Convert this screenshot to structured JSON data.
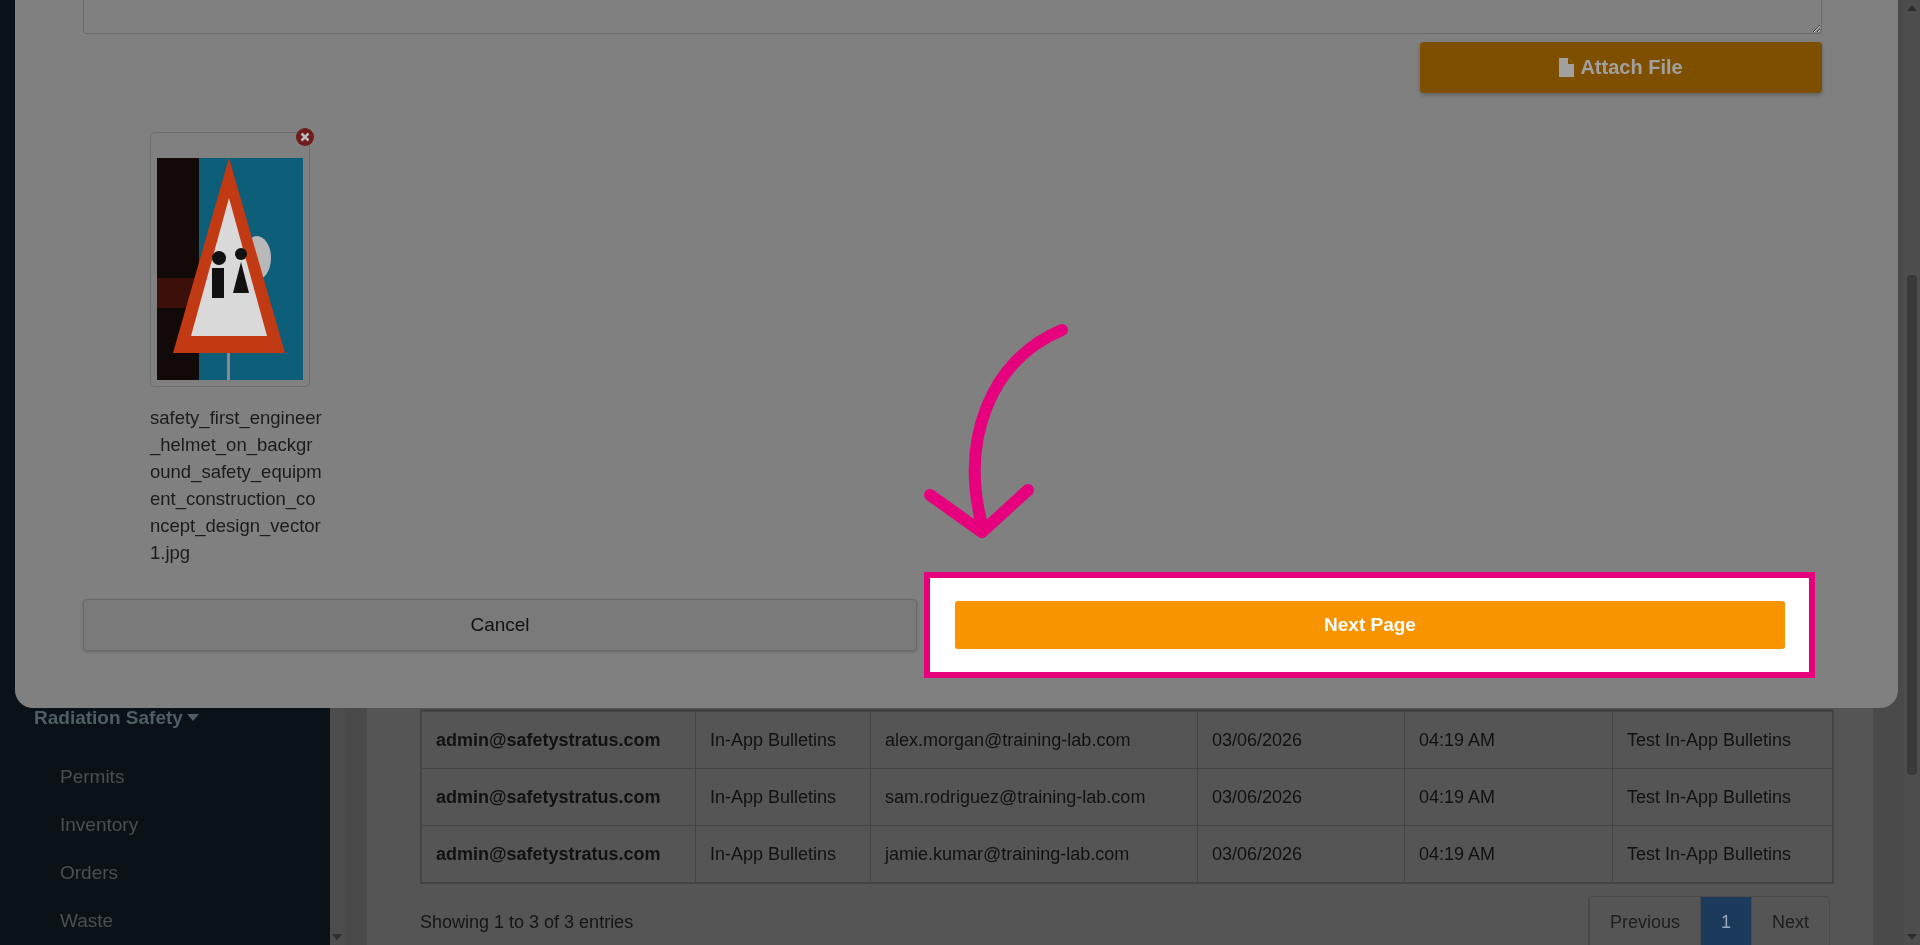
{
  "sidebar": {
    "section": {
      "label": "Radiation Safety",
      "expanded": true,
      "items": [
        "Permits",
        "Inventory",
        "Orders",
        "Waste"
      ]
    }
  },
  "table": {
    "rows": [
      {
        "cells": [
          "admin@safetystratus.com",
          "In-App Bulletins",
          "alex.morgan@training-lab.com",
          "03/06/2026",
          "04:19 AM",
          "Test In-App Bulletins"
        ]
      },
      {
        "cells": [
          "admin@safetystratus.com",
          "In-App Bulletins",
          "sam.rodriguez@training-lab.com",
          "03/06/2026",
          "04:19 AM",
          "Test In-App Bulletins"
        ]
      },
      {
        "cells": [
          "admin@safetystratus.com",
          "In-App Bulletins",
          "jamie.kumar@training-lab.com",
          "03/06/2026",
          "04:19 AM",
          "Test In-App Bulletins"
        ]
      }
    ]
  },
  "footer": {
    "summary": "Showing 1 to 3 of 3 entries",
    "pagination": [
      {
        "label": "Previous",
        "selected": false
      },
      {
        "label": "1",
        "selected": true
      },
      {
        "label": "Next",
        "selected": false
      }
    ]
  },
  "modal": {
    "attach_button": "Attach File",
    "attachments": [
      {
        "kind": "picture",
        "filename": "safety_first_engineer_helmet_on_background_safety_equipment_construction_concept_design_vector1.jpg"
      }
    ],
    "cancel_button": "Cancel",
    "next_button": "Next Page"
  }
}
